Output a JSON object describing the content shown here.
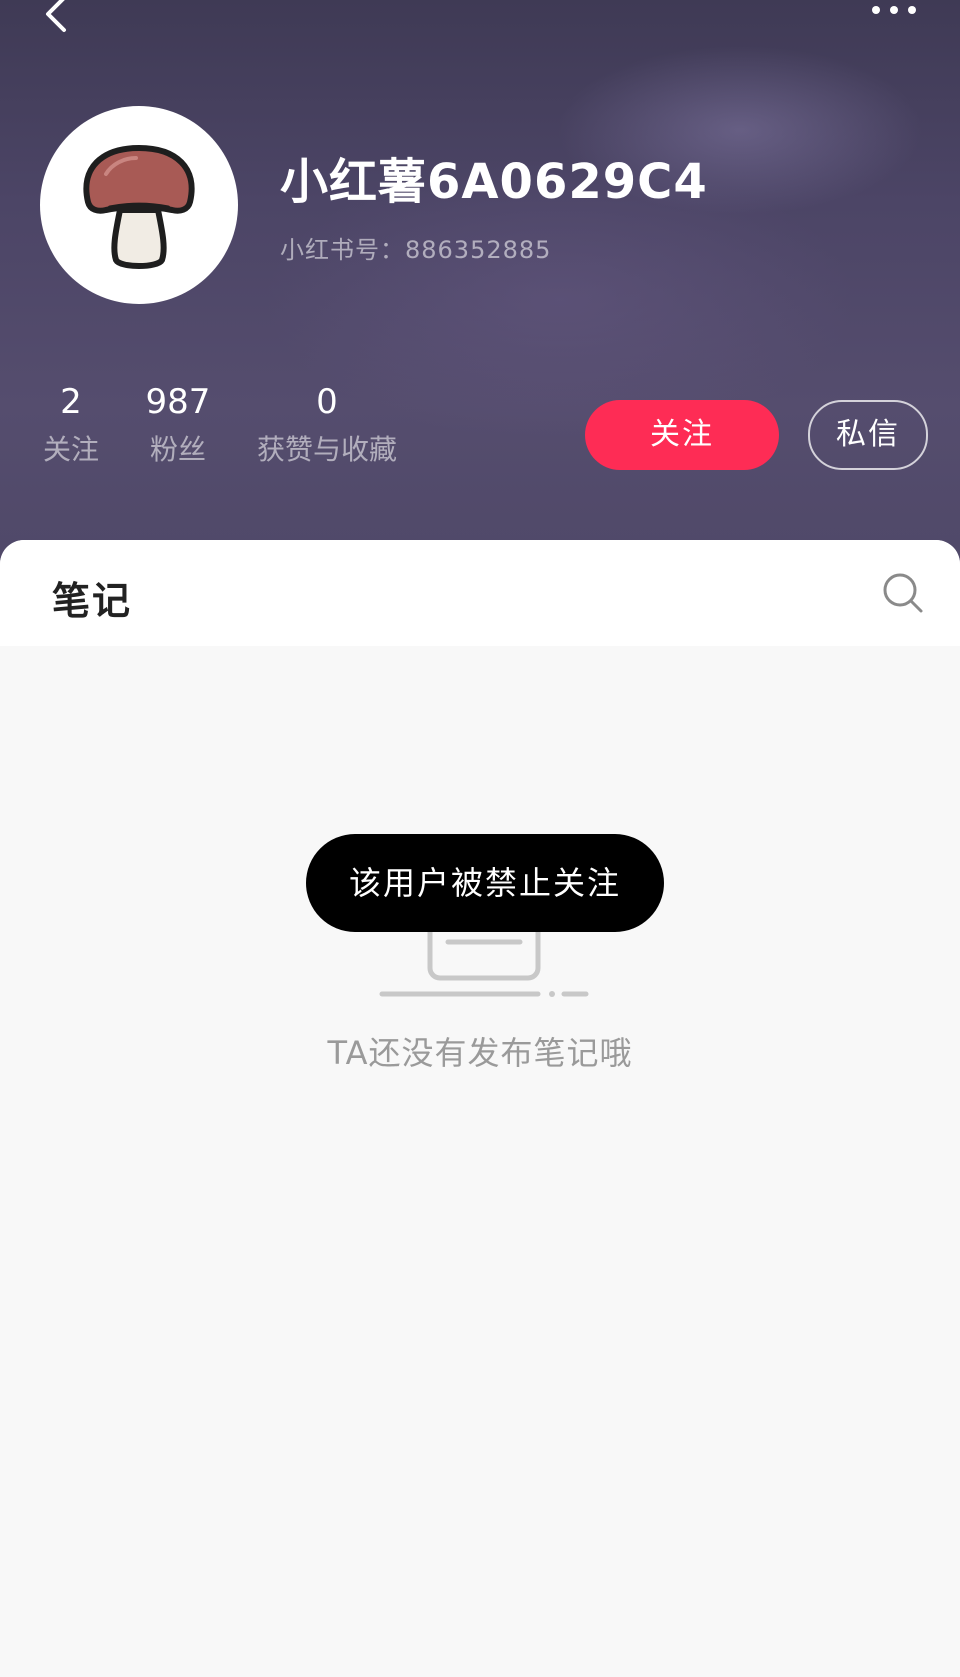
{
  "profile": {
    "username": "小红薯6A0629C4",
    "user_id_label": "小红书号：886352885",
    "avatar_icon": "mushroom-icon"
  },
  "stats": {
    "following": {
      "count": "2",
      "label": "关注"
    },
    "fans": {
      "count": "987",
      "label": "粉丝"
    },
    "likes": {
      "count": "0",
      "label": "获赞与收藏"
    }
  },
  "actions": {
    "follow_label": "关注",
    "message_label": "私信"
  },
  "tabs": {
    "notes_label": "笔记"
  },
  "empty_state": {
    "text": "TA还没有发布笔记哦"
  },
  "toast": {
    "text": "该用户被禁止关注"
  },
  "colors": {
    "follow_button": "#fe2c55",
    "header_bg": "#4c4566",
    "toast_bg": "#000000",
    "page_bg": "#f8f8f8"
  },
  "icons": {
    "back": "chevron-left-icon",
    "more": "more-dots-icon",
    "search": "search-icon"
  }
}
